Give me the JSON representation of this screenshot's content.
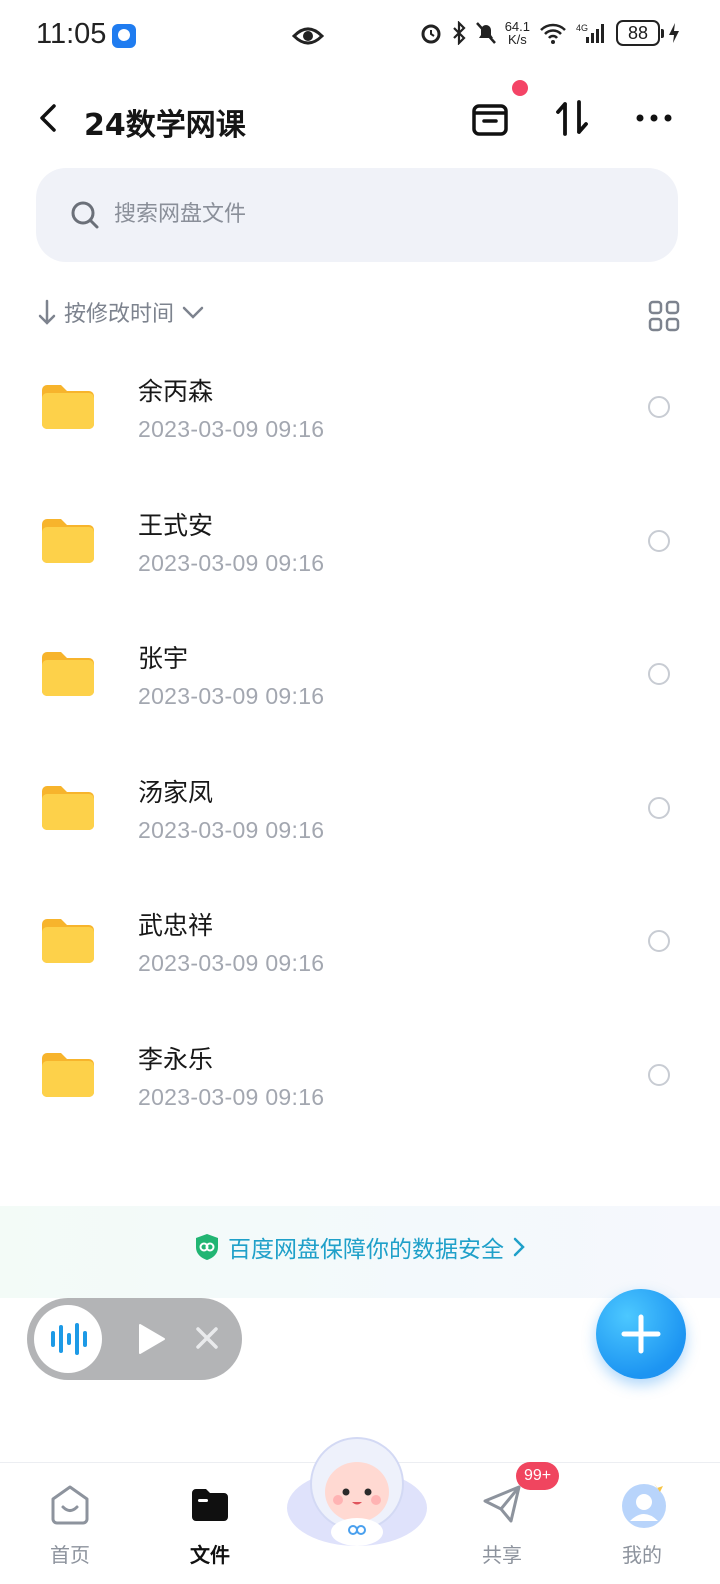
{
  "status_bar": {
    "time": "11:05",
    "net_speed_value": "64.1",
    "net_speed_unit": "K/s",
    "battery": "88"
  },
  "header": {
    "title": "24数学网课"
  },
  "search": {
    "placeholder": "搜索网盘文件"
  },
  "sort": {
    "label": "按修改时间"
  },
  "files": [
    {
      "name": "余丙森",
      "modified": "2023-03-09  09:16"
    },
    {
      "name": "王式安",
      "modified": "2023-03-09  09:16"
    },
    {
      "name": "张宇",
      "modified": "2023-03-09  09:16"
    },
    {
      "name": "汤家凤",
      "modified": "2023-03-09  09:16"
    },
    {
      "name": "武忠祥",
      "modified": "2023-03-09  09:16"
    },
    {
      "name": "李永乐",
      "modified": "2023-03-09  09:16"
    }
  ],
  "safety_banner": {
    "text": "百度网盘保障你的数据安全",
    "color": "#1fa0c9"
  },
  "bottom_nav": {
    "items": [
      {
        "label": "首页",
        "icon": "home-icon"
      },
      {
        "label": "文件",
        "icon": "file-icon"
      },
      {
        "label": "共享",
        "icon": "share-icon"
      },
      {
        "label": "我的",
        "icon": "profile-icon"
      }
    ],
    "share_badge": "99+"
  },
  "colors": {
    "folder": "#fcc43a",
    "accent": "#1d95f2",
    "badge": "#f0455f"
  }
}
